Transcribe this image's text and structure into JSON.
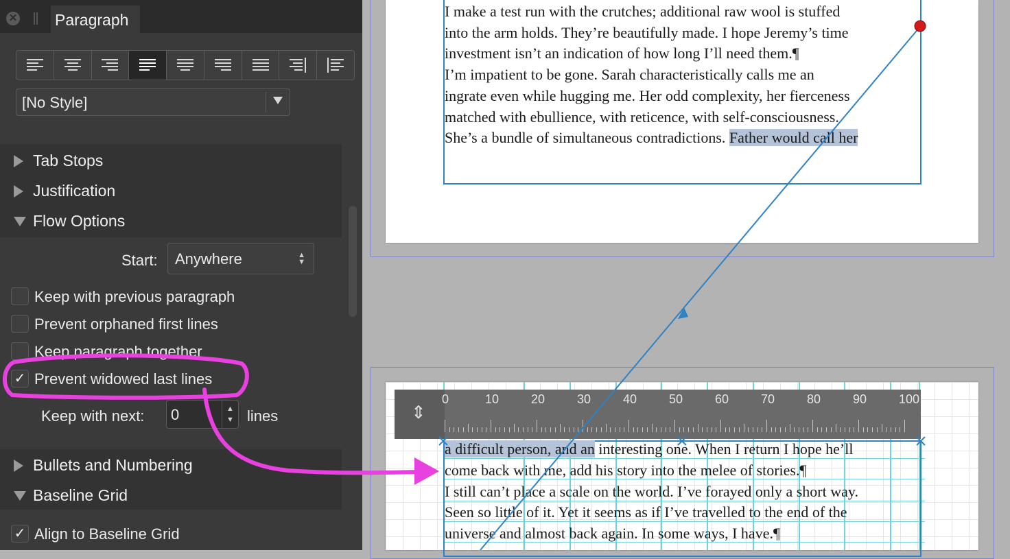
{
  "panel": {
    "title": "Paragraph",
    "close_icon": "✕",
    "style_value": "[No Style]",
    "alignment_buttons": [
      "align-left",
      "align-center",
      "align-right",
      "justify-left",
      "justify-center",
      "justify-right",
      "justify-all",
      "align-towards-spine",
      "align-away-from-spine"
    ],
    "active_alignment": "justify-left",
    "sections": {
      "tab_stops": "Tab Stops",
      "justification": "Justification",
      "flow_options": "Flow Options",
      "bullets": "Bullets and Numbering",
      "baseline_grid": "Baseline Grid"
    },
    "flow": {
      "start_label": "Start:",
      "start_value": "Anywhere",
      "keep_with_previous": "Keep with previous paragraph",
      "prevent_orphans": "Prevent orphaned first lines",
      "keep_together": "Keep paragraph together",
      "prevent_widows": "Prevent widowed last lines",
      "keep_with_next_label": "Keep with next:",
      "keep_with_next_value": "0",
      "lines_label": "lines",
      "check_mark": "✓"
    },
    "baseline": {
      "align_label": "Align to Baseline Grid"
    }
  },
  "document": {
    "page1_lines": [
      "     I make a test run with the crutches; additional raw wool is stuffed",
      "into the arm holds. They’re beautifully made. I hope Jeremy’s time",
      "investment isn’t an indication of how long I’ll need them.¶",
      "     I’m impatient to be gone. Sarah characteristically calls me an",
      "ingrate even while hugging me. Her odd complexity, her fierceness",
      "matched with ebullience, with reticence, with self-consciousness.",
      "She’s a bundle of simultaneous contradictions. "
    ],
    "page1_highlight": "Father would call her",
    "page2_line1_highlight": "a difficult person, and an",
    "page2_line1_rest": " interesting one. When I return I hope he’ll",
    "page2_lines": [
      "come back with me, add his story into the melee of stories.¶",
      "     I still can’t place a scale on the world. I’ve forayed only a short way.",
      "Seen so little of it. Yet it seems as if I’ve travelled to the end of the",
      "universe and almost back again. In some ways, I have.¶"
    ],
    "ruler_labels": [
      "0",
      "10",
      "20",
      "30",
      "40",
      "50",
      "60",
      "70",
      "80",
      "90",
      "100"
    ],
    "ruler_icon": "⇕"
  },
  "colors": {
    "annotation": "#e940e0",
    "link_line": "#2f82c4",
    "highlight": "#b4c3d7",
    "baseline": "#6fd2dc"
  }
}
